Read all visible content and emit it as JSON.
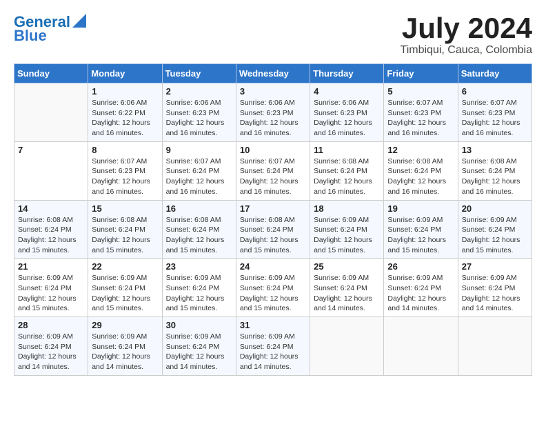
{
  "header": {
    "logo_line1": "General",
    "logo_line2": "Blue",
    "month": "July 2024",
    "location": "Timbiqui, Cauca, Colombia"
  },
  "weekdays": [
    "Sunday",
    "Monday",
    "Tuesday",
    "Wednesday",
    "Thursday",
    "Friday",
    "Saturday"
  ],
  "weeks": [
    [
      {
        "day": "",
        "info": ""
      },
      {
        "day": "1",
        "info": "Sunrise: 6:06 AM\nSunset: 6:22 PM\nDaylight: 12 hours and 16 minutes."
      },
      {
        "day": "2",
        "info": "Sunrise: 6:06 AM\nSunset: 6:23 PM\nDaylight: 12 hours and 16 minutes."
      },
      {
        "day": "3",
        "info": "Sunrise: 6:06 AM\nSunset: 6:23 PM\nDaylight: 12 hours and 16 minutes."
      },
      {
        "day": "4",
        "info": "Sunrise: 6:06 AM\nSunset: 6:23 PM\nDaylight: 12 hours and 16 minutes."
      },
      {
        "day": "5",
        "info": "Sunrise: 6:07 AM\nSunset: 6:23 PM\nDaylight: 12 hours and 16 minutes."
      },
      {
        "day": "6",
        "info": "Sunrise: 6:07 AM\nSunset: 6:23 PM\nDaylight: 12 hours and 16 minutes."
      }
    ],
    [
      {
        "day": "7",
        "info": ""
      },
      {
        "day": "8",
        "info": "Sunrise: 6:07 AM\nSunset: 6:23 PM\nDaylight: 12 hours and 16 minutes."
      },
      {
        "day": "9",
        "info": "Sunrise: 6:07 AM\nSunset: 6:24 PM\nDaylight: 12 hours and 16 minutes."
      },
      {
        "day": "10",
        "info": "Sunrise: 6:07 AM\nSunset: 6:24 PM\nDaylight: 12 hours and 16 minutes."
      },
      {
        "day": "11",
        "info": "Sunrise: 6:08 AM\nSunset: 6:24 PM\nDaylight: 12 hours and 16 minutes."
      },
      {
        "day": "12",
        "info": "Sunrise: 6:08 AM\nSunset: 6:24 PM\nDaylight: 12 hours and 16 minutes."
      },
      {
        "day": "13",
        "info": "Sunrise: 6:08 AM\nSunset: 6:24 PM\nDaylight: 12 hours and 16 minutes."
      }
    ],
    [
      {
        "day": "14",
        "info": "Sunrise: 6:08 AM\nSunset: 6:24 PM\nDaylight: 12 hours and 15 minutes."
      },
      {
        "day": "15",
        "info": "Sunrise: 6:08 AM\nSunset: 6:24 PM\nDaylight: 12 hours and 15 minutes."
      },
      {
        "day": "16",
        "info": "Sunrise: 6:08 AM\nSunset: 6:24 PM\nDaylight: 12 hours and 15 minutes."
      },
      {
        "day": "17",
        "info": "Sunrise: 6:08 AM\nSunset: 6:24 PM\nDaylight: 12 hours and 15 minutes."
      },
      {
        "day": "18",
        "info": "Sunrise: 6:09 AM\nSunset: 6:24 PM\nDaylight: 12 hours and 15 minutes."
      },
      {
        "day": "19",
        "info": "Sunrise: 6:09 AM\nSunset: 6:24 PM\nDaylight: 12 hours and 15 minutes."
      },
      {
        "day": "20",
        "info": "Sunrise: 6:09 AM\nSunset: 6:24 PM\nDaylight: 12 hours and 15 minutes."
      }
    ],
    [
      {
        "day": "21",
        "info": "Sunrise: 6:09 AM\nSunset: 6:24 PM\nDaylight: 12 hours and 15 minutes."
      },
      {
        "day": "22",
        "info": "Sunrise: 6:09 AM\nSunset: 6:24 PM\nDaylight: 12 hours and 15 minutes."
      },
      {
        "day": "23",
        "info": "Sunrise: 6:09 AM\nSunset: 6:24 PM\nDaylight: 12 hours and 15 minutes."
      },
      {
        "day": "24",
        "info": "Sunrise: 6:09 AM\nSunset: 6:24 PM\nDaylight: 12 hours and 15 minutes."
      },
      {
        "day": "25",
        "info": "Sunrise: 6:09 AM\nSunset: 6:24 PM\nDaylight: 12 hours and 14 minutes."
      },
      {
        "day": "26",
        "info": "Sunrise: 6:09 AM\nSunset: 6:24 PM\nDaylight: 12 hours and 14 minutes."
      },
      {
        "day": "27",
        "info": "Sunrise: 6:09 AM\nSunset: 6:24 PM\nDaylight: 12 hours and 14 minutes."
      }
    ],
    [
      {
        "day": "28",
        "info": "Sunrise: 6:09 AM\nSunset: 6:24 PM\nDaylight: 12 hours and 14 minutes."
      },
      {
        "day": "29",
        "info": "Sunrise: 6:09 AM\nSunset: 6:24 PM\nDaylight: 12 hours and 14 minutes."
      },
      {
        "day": "30",
        "info": "Sunrise: 6:09 AM\nSunset: 6:24 PM\nDaylight: 12 hours and 14 minutes."
      },
      {
        "day": "31",
        "info": "Sunrise: 6:09 AM\nSunset: 6:24 PM\nDaylight: 12 hours and 14 minutes."
      },
      {
        "day": "",
        "info": ""
      },
      {
        "day": "",
        "info": ""
      },
      {
        "day": "",
        "info": ""
      }
    ]
  ]
}
